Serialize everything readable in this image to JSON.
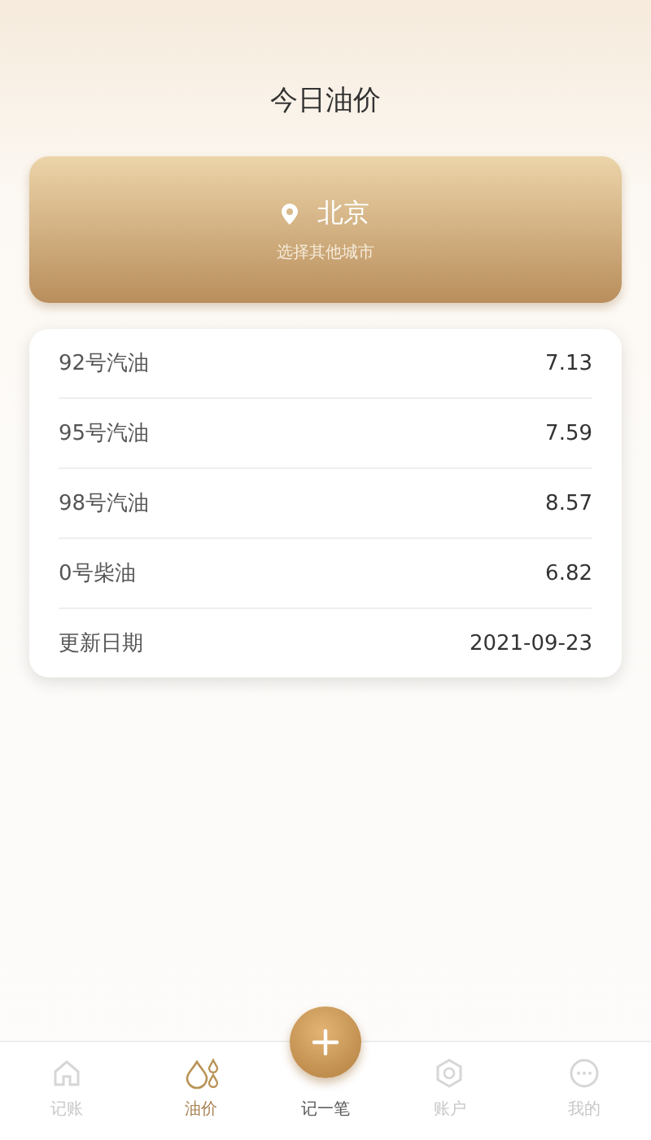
{
  "header": {
    "title": "今日油价"
  },
  "city_card": {
    "city": "北京",
    "hint": "选择其他城市"
  },
  "prices": [
    {
      "name": "92号汽油",
      "value": "7.13"
    },
    {
      "name": "95号汽油",
      "value": "7.59"
    },
    {
      "name": "98号汽油",
      "value": "8.57"
    },
    {
      "name": "0号柴油",
      "value": "6.82"
    },
    {
      "name": "更新日期",
      "value": "2021-09-23"
    }
  ],
  "nav": [
    {
      "kind": "home",
      "label": "记账",
      "selected": false
    },
    {
      "kind": "oil",
      "label": "油价",
      "selected": true
    },
    {
      "kind": "add",
      "label": "记一笔",
      "selected": false
    },
    {
      "kind": "account",
      "label": "账户",
      "selected": false
    },
    {
      "kind": "more",
      "label": "我的",
      "selected": false
    }
  ]
}
